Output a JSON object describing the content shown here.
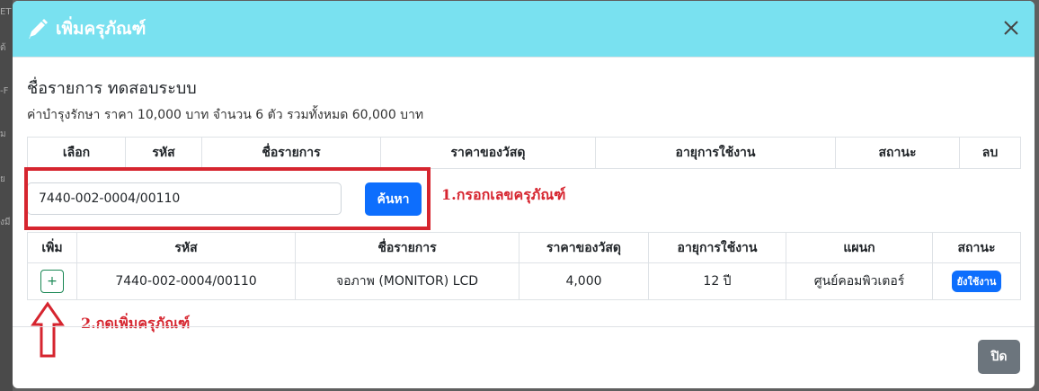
{
  "modal": {
    "title": "เพิ่มครุภัณฑ์",
    "item_title": "ชื่อรายการ ทดสอบระบบ",
    "item_summary": "ค่าบำรุงรักษา ราคา 10,000 บาท จำนวน 6 ตัว รวมทั้งหมด 60,000 บาท",
    "close_label": "ปิด"
  },
  "selected_table": {
    "headers": [
      "เลือก",
      "รหัส",
      "ชื่อรายการ",
      "ราคาของวัสดุ",
      "อายุการใช้งาน",
      "สถานะ",
      "ลบ"
    ]
  },
  "search": {
    "value": "7440-002-0004/00110",
    "button_label": "ค้นหา"
  },
  "results_table": {
    "headers": [
      "เพิ่ม",
      "รหัส",
      "ชื่อรายการ",
      "ราคาของวัสดุ",
      "อายุการใช้งาน",
      "แผนก",
      "สถานะ"
    ],
    "rows": [
      {
        "add": "+",
        "code": "7440-002-0004/00110",
        "name": "จอภาพ (MONITOR) LCD",
        "price": "4,000",
        "lifetime": "12 ปี",
        "department": "ศูนย์คอมพิวเตอร์",
        "status": "ยังใช้งาน"
      }
    ]
  },
  "annotations": {
    "step1": "1.กรอกเลขครุภัณฑ์",
    "step2": "2.กดเพิ่มครุภัณฑ์"
  },
  "background_fragments": [
    "ET",
    "ด้",
    "-F",
    "ม",
    "ย",
    "งมี"
  ],
  "colors": {
    "header_bg": "#79e1f0",
    "primary": "#0d6efd",
    "success": "#198754",
    "annotation_red": "#d6252f",
    "secondary": "#6c757d"
  },
  "icons": [
    "pencil-icon",
    "close-icon",
    "plus-icon",
    "arrow-up-icon"
  ]
}
